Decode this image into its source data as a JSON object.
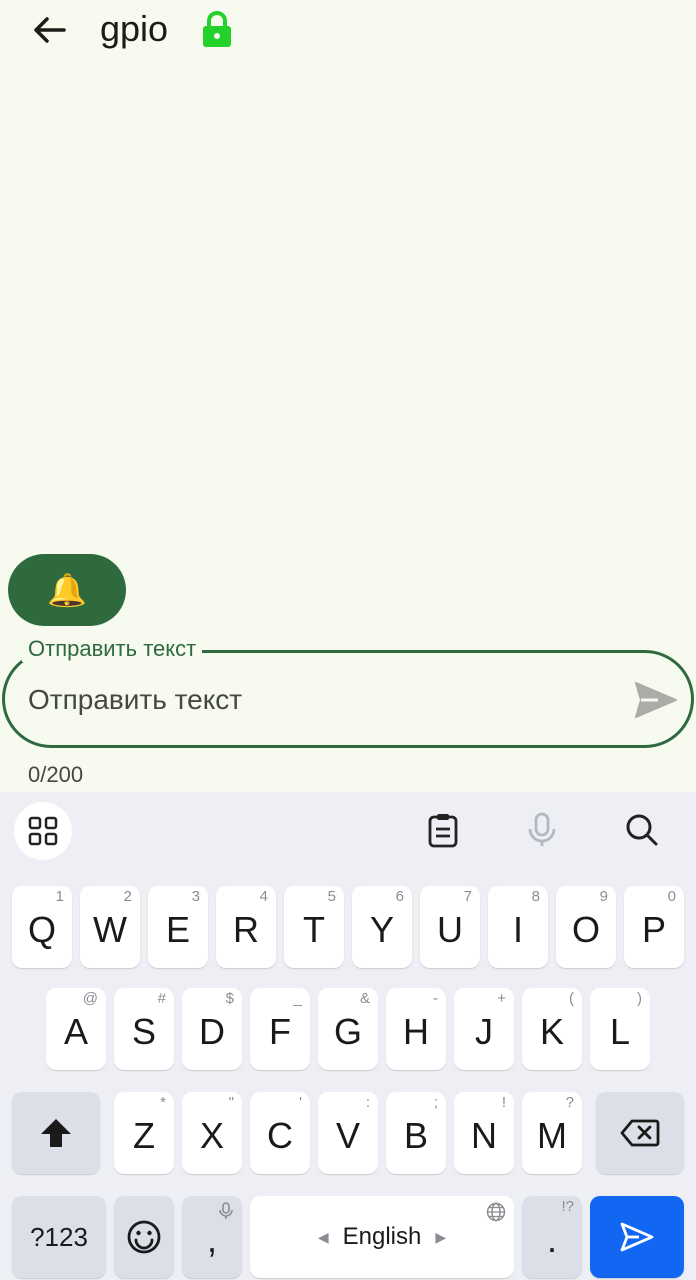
{
  "header": {
    "title": "gpio"
  },
  "composer": {
    "label": "Отправить текст",
    "placeholder": "Отправить текст",
    "counter": "0/200"
  },
  "keyboard": {
    "row1": [
      {
        "c": "Q",
        "h": "1"
      },
      {
        "c": "W",
        "h": "2"
      },
      {
        "c": "E",
        "h": "3"
      },
      {
        "c": "R",
        "h": "4"
      },
      {
        "c": "T",
        "h": "5"
      },
      {
        "c": "Y",
        "h": "6"
      },
      {
        "c": "U",
        "h": "7"
      },
      {
        "c": "I",
        "h": "8"
      },
      {
        "c": "O",
        "h": "9"
      },
      {
        "c": "P",
        "h": "0"
      }
    ],
    "row2": [
      {
        "c": "A",
        "h": "@"
      },
      {
        "c": "S",
        "h": "#"
      },
      {
        "c": "D",
        "h": "$"
      },
      {
        "c": "F",
        "h": "_"
      },
      {
        "c": "G",
        "h": "&"
      },
      {
        "c": "H",
        "h": "-"
      },
      {
        "c": "J",
        "h": "+"
      },
      {
        "c": "K",
        "h": "("
      },
      {
        "c": "L",
        "h": ")"
      }
    ],
    "row3": [
      {
        "c": "Z",
        "h": "*"
      },
      {
        "c": "X",
        "h": "\""
      },
      {
        "c": "C",
        "h": "'"
      },
      {
        "c": "V",
        "h": ":"
      },
      {
        "c": "B",
        "h": ";"
      },
      {
        "c": "N",
        "h": "!"
      },
      {
        "c": "M",
        "h": "?"
      }
    ],
    "symbols_label": "?123",
    "comma": ",",
    "space_label": "English",
    "period": ".",
    "period_hint": "!?"
  },
  "colors": {
    "accent": "#2F6A3F",
    "lock": "#22D22A",
    "enter": "#1167F2"
  },
  "icons": [
    "back-arrow-icon",
    "lock-icon",
    "bell-icon",
    "send-icon",
    "apps-grid-icon",
    "clipboard-icon",
    "mic-icon",
    "search-icon",
    "shift-icon",
    "backspace-icon",
    "emoji-icon",
    "globe-icon",
    "enter-icon"
  ]
}
